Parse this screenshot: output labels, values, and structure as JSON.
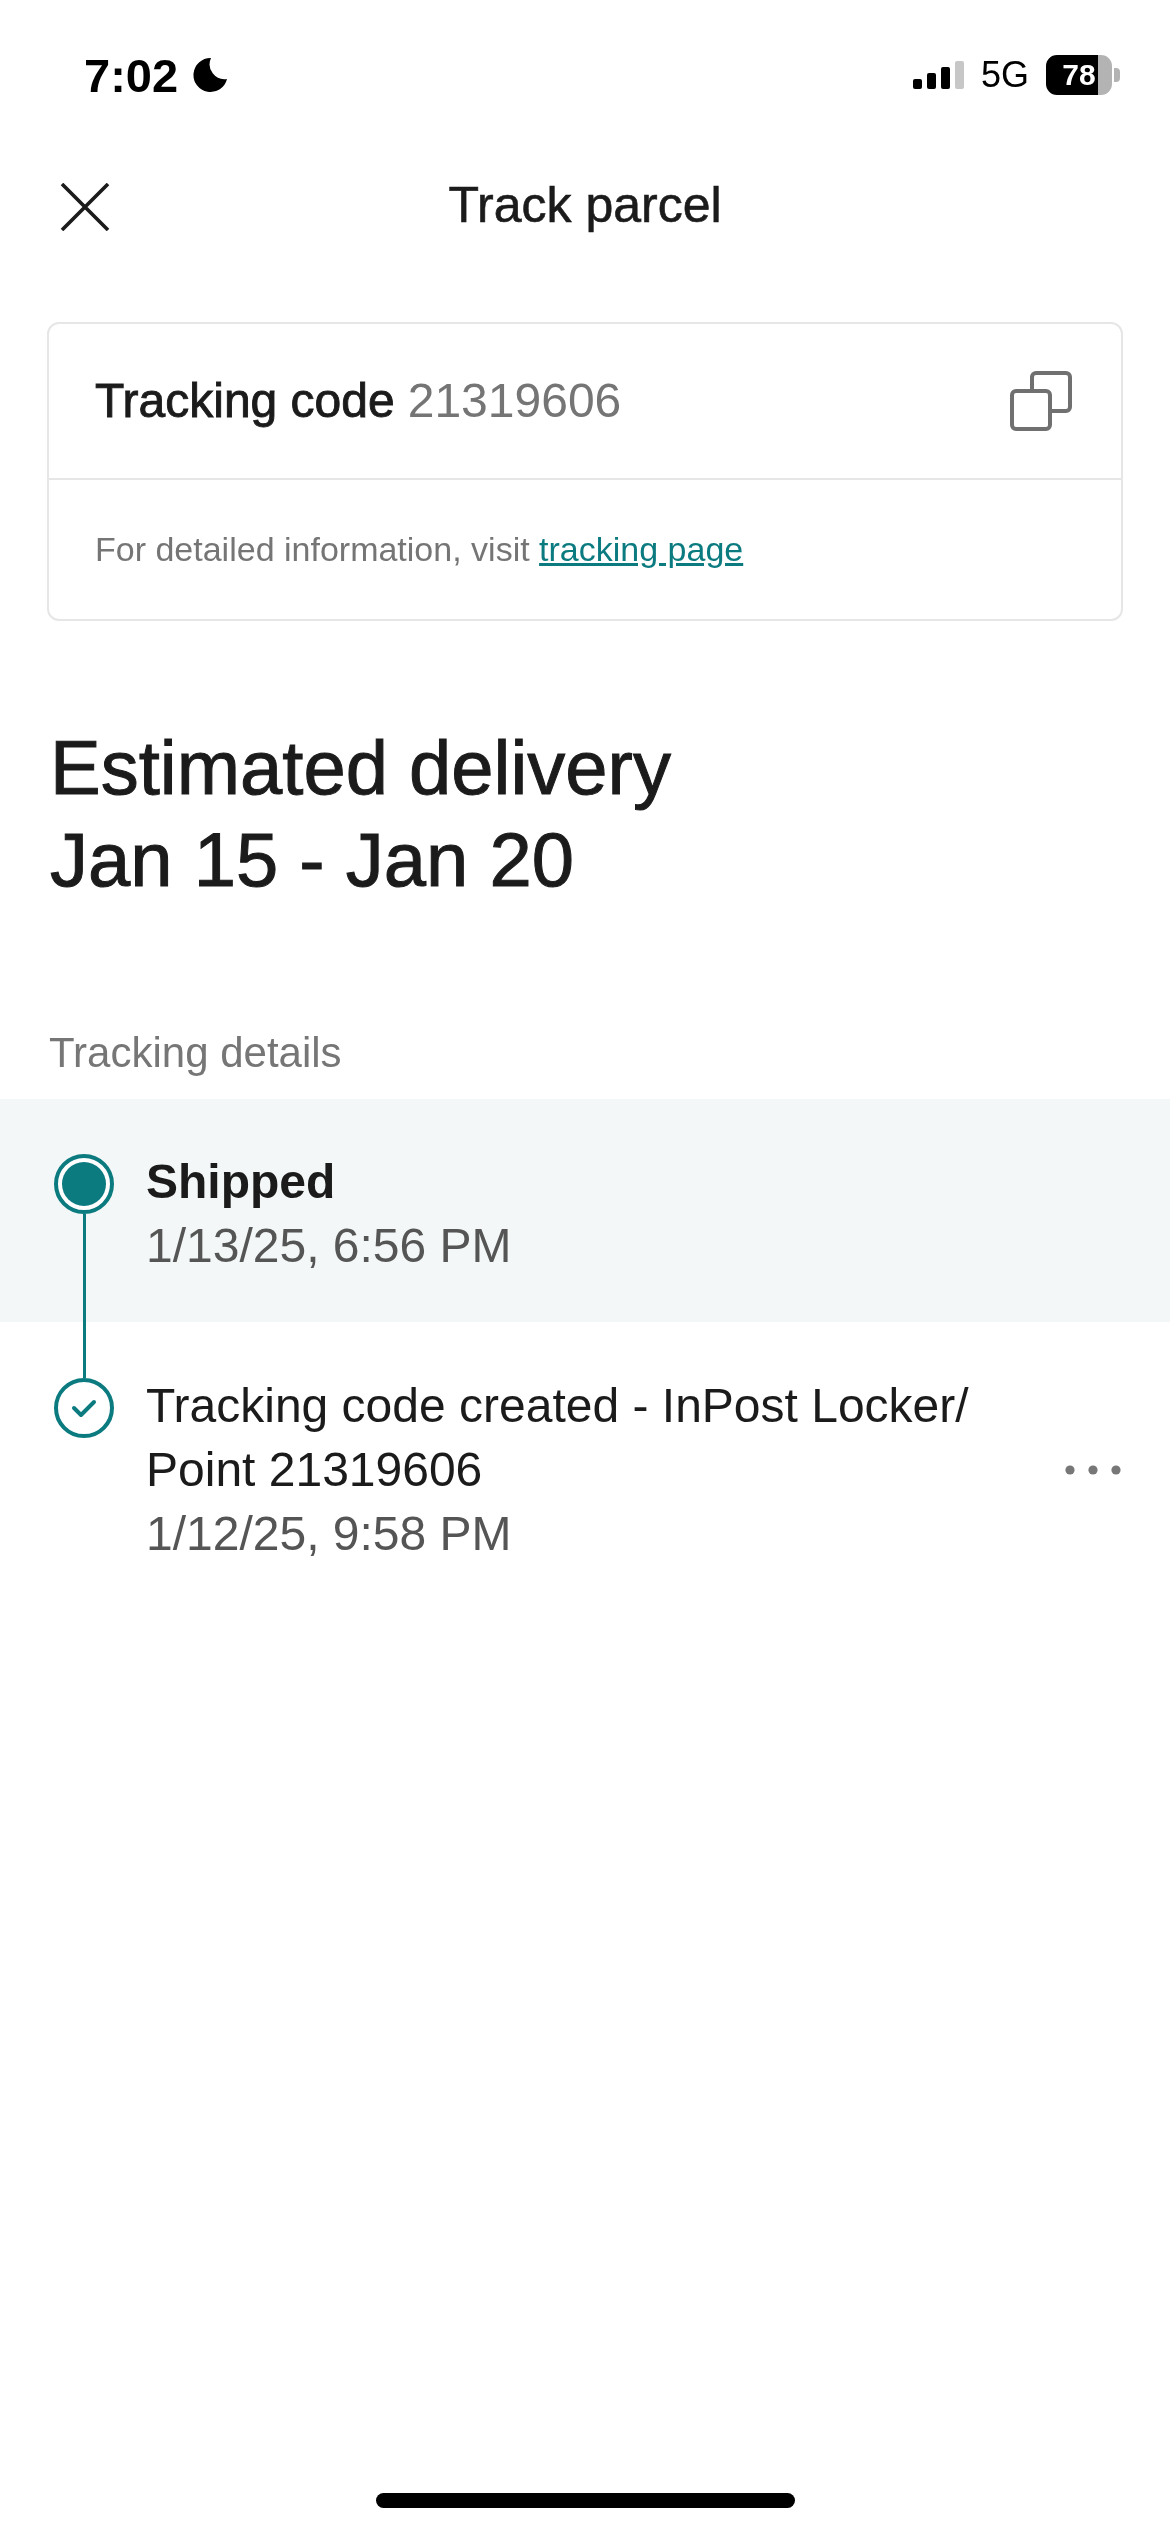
{
  "status_bar": {
    "time": "7:02",
    "network": "5G",
    "battery": "78"
  },
  "header": {
    "title": "Track parcel"
  },
  "tracking_card": {
    "label": "Tracking code",
    "code": "21319606",
    "info_text": "For detailed information, visit",
    "link": "tracking page"
  },
  "estimate": {
    "title": "Estimated delivery",
    "range": "Jan 15 - Jan 20"
  },
  "tracking_details": {
    "heading": "Tracking details",
    "events": [
      {
        "title": "Shipped",
        "time": "1/13/25, 6:56 PM",
        "current": true,
        "menu": false
      },
      {
        "title": "Tracking code created - InPost Locker/ Point 21319606",
        "time": "1/12/25, 9:58 PM",
        "current": false,
        "menu": true
      }
    ]
  }
}
